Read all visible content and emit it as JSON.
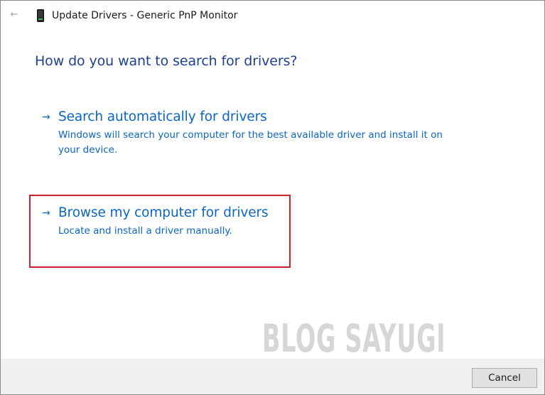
{
  "window": {
    "title": "Update Drivers - Generic PnP Monitor"
  },
  "titlebar": {
    "back_icon": "back-arrow-icon",
    "device_icon": "monitor-device-icon"
  },
  "main": {
    "heading": "How do you want to search for drivers?",
    "options": [
      {
        "title": "Search automatically for drivers",
        "description": "Windows will search your computer for the best available driver and install it on your device.",
        "icon": "arrow-right-icon"
      },
      {
        "title": "Browse my computer for drivers",
        "description": "Locate and install a driver manually.",
        "icon": "arrow-right-icon"
      }
    ]
  },
  "watermark": "BLOG SAYUGI",
  "footer": {
    "cancel_label": "Cancel"
  },
  "colors": {
    "heading": "#1e3f8f",
    "link": "#0a66c2",
    "highlight": "#d0202c",
    "footer_bg": "#f0f0f0"
  }
}
